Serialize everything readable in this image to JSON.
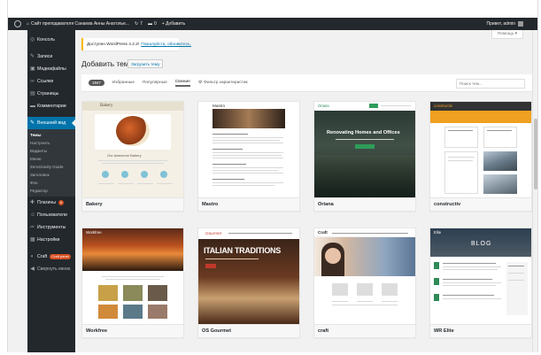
{
  "adminbar": {
    "site_title": "Сайт преподавателя Санаева Анны Анатолье...",
    "updates_count": "7",
    "comments_count": "0",
    "new_label": "+ Добавить",
    "greeting": "Привет, admin"
  },
  "sidebar": {
    "items": [
      {
        "label": "Консоль",
        "icon": "dashboard-icon",
        "glyph": "◎"
      },
      {
        "label": "Записи",
        "icon": "pin-icon",
        "glyph": "✎"
      },
      {
        "label": "Медиафайлы",
        "icon": "media-icon",
        "glyph": "▣"
      },
      {
        "label": "Ссылки",
        "icon": "link-icon",
        "glyph": "∞"
      },
      {
        "label": "Страницы",
        "icon": "page-icon",
        "glyph": "▤"
      },
      {
        "label": "Комментарии",
        "icon": "comment-icon",
        "glyph": "▬"
      },
      {
        "label": "Внешний вид",
        "icon": "brush-icon",
        "glyph": "✎"
      }
    ],
    "submenu": [
      "Темы",
      "Настроить",
      "Виджеты",
      "Меню",
      "ZeroGravity Guide",
      "Заголовок",
      "Фон",
      "Редактор"
    ],
    "lower_items": [
      {
        "label": "Плагины",
        "icon": "plugin-icon",
        "glyph": "✚",
        "badge": "6"
      },
      {
        "label": "Пользователи",
        "icon": "users-icon",
        "glyph": "☺"
      },
      {
        "label": "Инструменты",
        "icon": "tools-icon",
        "glyph": "✑"
      },
      {
        "label": "Настройки",
        "icon": "settings-icon",
        "glyph": "▦"
      }
    ],
    "craft_item": {
      "label": "Craft",
      "badge": "Craft panel",
      "glyph": "◐"
    },
    "collapse_label": "Свернуть меню"
  },
  "help_tab": "Помощь ▾",
  "notice": {
    "text": "Доступен WordPress 4.2.2!",
    "link": "Пожалуйста, обновитесь."
  },
  "page_title": "Добавить темы",
  "upload_button": "Загрузить тему",
  "filters": {
    "count": "1947",
    "tabs": [
      "Избранные",
      "Популярные",
      "Свежие"
    ],
    "current": "Свежие",
    "feature_filter": "Фильтр характеристик",
    "search_placeholder": "Поиск тем..."
  },
  "themes": [
    {
      "name": "Bakery"
    },
    {
      "name": "Mastro"
    },
    {
      "name": "Oriana"
    },
    {
      "name": "constructiv"
    },
    {
      "name": "Workfree"
    },
    {
      "name": "OS Gourmet"
    },
    {
      "name": "craft"
    },
    {
      "name": "WR Elite"
    }
  ],
  "thumb_text": {
    "bakery_logo": "Bakery",
    "bakery_heading": "Our Awesome Bakery",
    "mastro_logo": "Mastro",
    "oriana_logo": "Oriana",
    "oriana_hero": "Renovating Homes and Offices",
    "constructiv_logo": "constructiv",
    "workfree_logo": "Workfree",
    "gourmet_logo": "Gourmet",
    "gourmet_hero": "ITALIAN TRADITIONS",
    "craft_logo": "Craft",
    "wrelite_logo": "Elite",
    "wrelite_blog": "BLOG"
  },
  "colors": {
    "sidebar_bg": "#23282d",
    "active_blue": "#0073aa",
    "notice_border": "#ffb900"
  }
}
